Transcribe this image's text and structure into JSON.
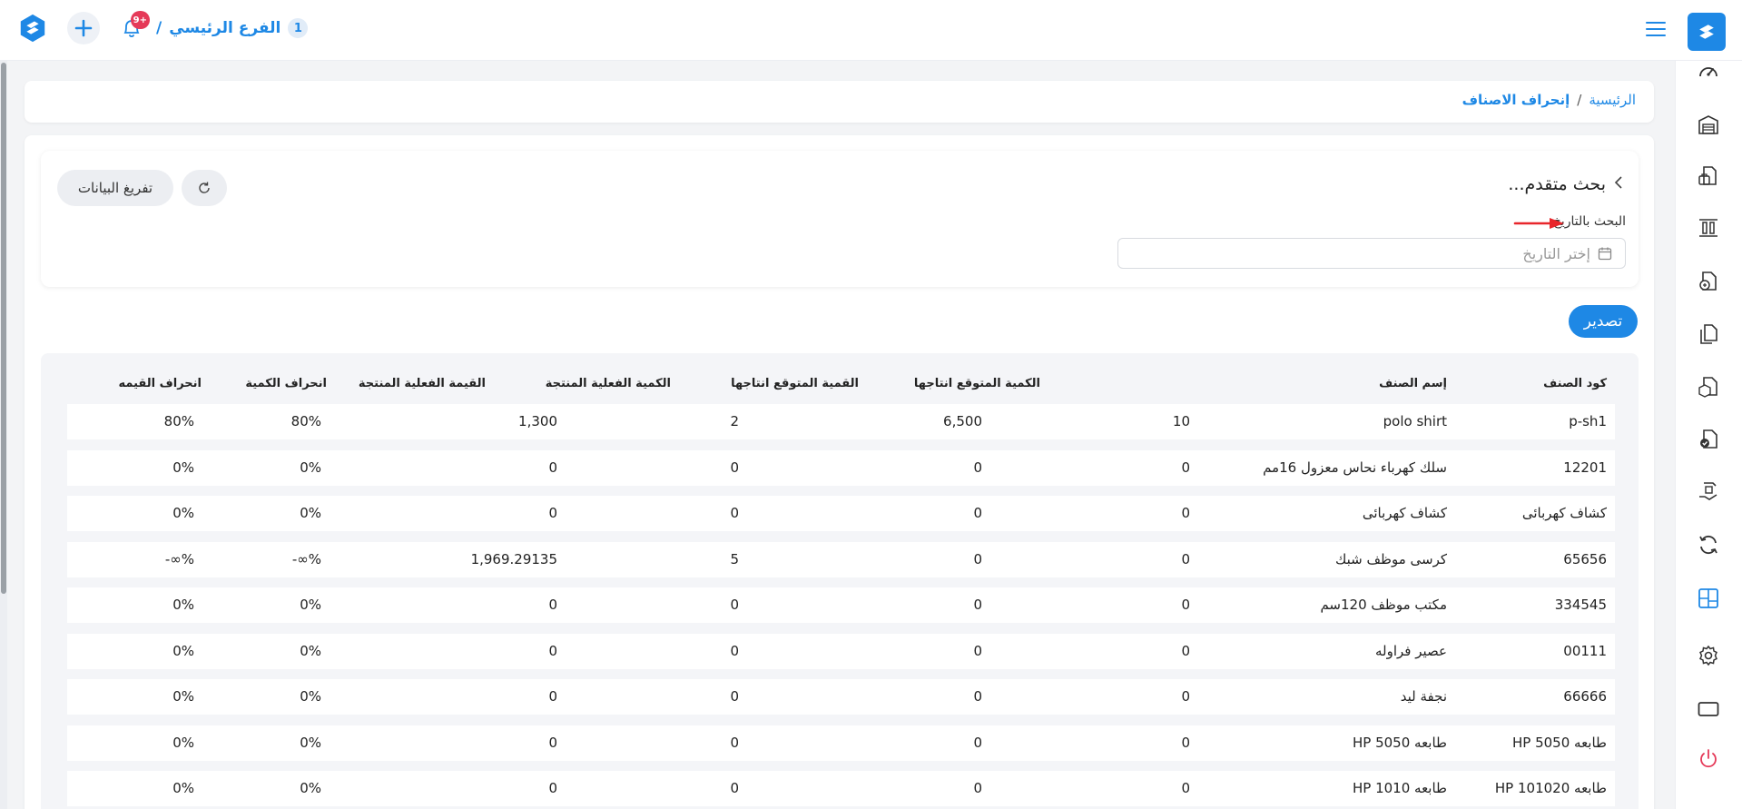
{
  "topbar": {
    "notification_count": "9+",
    "branch_number": "1",
    "branch_name": "الفرع الرئيسي",
    "branch_separator": "/"
  },
  "breadcrumb": {
    "home": "الرئيسية",
    "separator": "/",
    "current": "إنحراف الاصناف"
  },
  "search": {
    "title": "بحث متقدم...",
    "date_label": "البحث بالتاريخ",
    "date_placeholder": "إختر التاريخ",
    "clear_label": "تفريغ البيانات"
  },
  "export_label": "تصدير",
  "table": {
    "headers": [
      "كود الصنف",
      "إسم الصنف",
      "الكمية المتوقع انتاجها",
      "القمية المتوقع انتاجها",
      "الكمية الفعلية المنتجة",
      "القيمة الفعلية المنتجة",
      "انحراف الكمية",
      "انحراف القيمه"
    ],
    "rows": [
      [
        "p-sh1",
        "polo shirt",
        "10",
        "6,500",
        "2",
        "1,300",
        "80%",
        "80%"
      ],
      [
        "12201",
        "سلك كهرباء نحاس معزول 16مم",
        "0",
        "0",
        "0",
        "0",
        "0%",
        "0%"
      ],
      [
        "كشاف كهربائى",
        "كشاف كهربائى",
        "0",
        "0",
        "0",
        "0",
        "0%",
        "0%"
      ],
      [
        "65656",
        "كرسى موظف شبك",
        "0",
        "0",
        "5",
        "1,969.29135",
        "-∞%",
        "-∞%"
      ],
      [
        "334545",
        "مكتب موظف 120سم",
        "0",
        "0",
        "0",
        "0",
        "0%",
        "0%"
      ],
      [
        "00111",
        "عصير فراوله",
        "0",
        "0",
        "0",
        "0",
        "0%",
        "0%"
      ],
      [
        "66666",
        "نجفة ليد",
        "0",
        "0",
        "0",
        "0",
        "0%",
        "0%"
      ],
      [
        "طابعه HP 5050",
        "طابعه HP 5050",
        "0",
        "0",
        "0",
        "0",
        "0%",
        "0%"
      ],
      [
        "طابعه HP 101020",
        "طابعه HP 1010",
        "0",
        "0",
        "0",
        "0",
        "0%",
        "0%"
      ]
    ]
  },
  "colors": {
    "accent": "#1e88e5",
    "badge": "#e53958",
    "power": "#e53958",
    "annotation_arrow": "#e8262b"
  },
  "icons": {
    "sidebar": [
      "dashboard-gauge-icon",
      "warehouse-icon",
      "briefcase-document-icon",
      "columns-icon",
      "document-exchange-icon",
      "document-copy-icon",
      "document-box-icon",
      "document-check-icon",
      "hand-transfer-icon",
      "sync-icon",
      "layout-grid-icon",
      "gear-icon",
      "monitor-icon",
      "power-icon"
    ]
  }
}
